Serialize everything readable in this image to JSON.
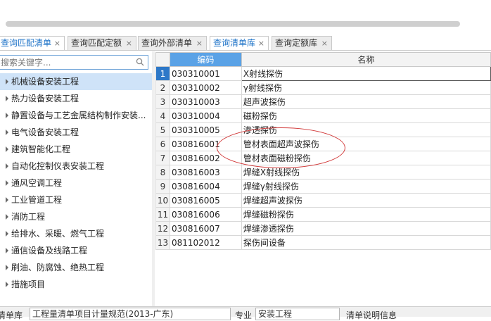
{
  "tabs": [
    {
      "label": "查询匹配清单",
      "active": true
    },
    {
      "label": "查询匹配定额",
      "active": false
    },
    {
      "label": "查询外部清单",
      "active": false
    },
    {
      "label": "查询清单库",
      "active": true
    },
    {
      "label": "查询定额库",
      "active": false
    }
  ],
  "search": {
    "placeholder": "搜索关键字..."
  },
  "tree": [
    "机械设备安装工程",
    "热力设备安装工程",
    "静置设备与工艺金属结构制作安装...",
    "电气设备安装工程",
    "建筑智能化工程",
    "自动化控制仪表安装工程",
    "通风空调工程",
    "工业管道工程",
    "消防工程",
    "给排水、采暖、燃气工程",
    "通信设备及线路工程",
    "刷油、防腐蚀、绝热工程",
    "措施项目"
  ],
  "grid": {
    "headers": {
      "code": "编码",
      "name": "名称"
    },
    "rows": [
      {
        "n": "1",
        "code": "030310001",
        "name": "X射线探伤"
      },
      {
        "n": "2",
        "code": "030310002",
        "name": "γ射线探伤"
      },
      {
        "n": "3",
        "code": "030310003",
        "name": "超声波探伤"
      },
      {
        "n": "4",
        "code": "030310004",
        "name": "磁粉探伤"
      },
      {
        "n": "5",
        "code": "030310005",
        "name": "渗透探伤"
      },
      {
        "n": "6",
        "code": "030816001",
        "name": "管材表面超声波探伤"
      },
      {
        "n": "7",
        "code": "030816002",
        "name": "管材表面磁粉探伤"
      },
      {
        "n": "8",
        "code": "030816003",
        "name": "焊缝X射线探伤"
      },
      {
        "n": "9",
        "code": "030816004",
        "name": "焊缝γ射线探伤"
      },
      {
        "n": "10",
        "code": "030816005",
        "name": "焊缝超声波探伤"
      },
      {
        "n": "11",
        "code": "030816006",
        "name": "焊缝磁粉探伤"
      },
      {
        "n": "12",
        "code": "030816007",
        "name": "焊缝渗透探伤"
      },
      {
        "n": "13",
        "code": "081102012",
        "name": "探伤间设备"
      }
    ]
  },
  "bottom": {
    "list_label": "清单库",
    "list_value": "工程量清单项目计量规范(2013-广东)",
    "major_label": "专业",
    "major_value": "安装工程",
    "desc_label": "清单说明信息"
  },
  "colors": {
    "accent": "#5aa2e6",
    "selected_row": "#2d78c8",
    "annotation": "#d23a3a"
  }
}
